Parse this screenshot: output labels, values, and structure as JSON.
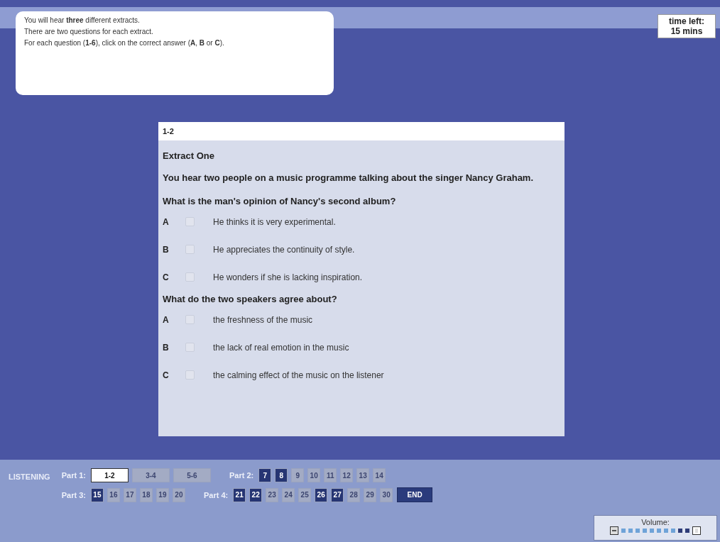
{
  "instructions": [
    "You will hear **three** different extracts.",
    "There are two questions for each extract.",
    "For each question (**1-6**), click on the correct answer (**A**, **B** or **C**)."
  ],
  "timer": {
    "label": "time left:",
    "value": "15 mins"
  },
  "panel": {
    "header": "1-2",
    "extract": "Extract One",
    "context": "You hear two people on a music programme talking about the singer Nancy Graham.",
    "questions": [
      {
        "text": "What is the man's opinion of Nancy's second album?",
        "options": [
          {
            "letter": "A",
            "text": "He thinks it is very experimental.",
            "selected": false
          },
          {
            "letter": "B",
            "text": "He appreciates the continuity of style.",
            "selected": false
          },
          {
            "letter": "C",
            "text": "He wonders if she is lacking inspiration.",
            "selected": false
          }
        ]
      },
      {
        "text": "What do the two speakers agree about?",
        "options": [
          {
            "letter": "A",
            "text": "the freshness of the music",
            "selected": false
          },
          {
            "letter": "B",
            "text": "the lack of real emotion in the music",
            "selected": false
          },
          {
            "letter": "C",
            "text": "the calming effect of the music on the listener",
            "selected": false
          }
        ]
      }
    ]
  },
  "navigation": {
    "section": "LISTENING",
    "rows": [
      {
        "parts": [
          {
            "label": "Part 1:",
            "kind": "range",
            "items": [
              {
                "label": "1-2",
                "selected": true,
                "answered": false
              },
              {
                "label": "3-4",
                "selected": false,
                "answered": false
              },
              {
                "label": "5-6",
                "selected": false,
                "answered": false
              }
            ]
          },
          {
            "label": "Part 2:",
            "kind": "number",
            "items": [
              {
                "label": "7",
                "selected": false,
                "answered": true
              },
              {
                "label": "8",
                "selected": false,
                "answered": true
              },
              {
                "label": "9",
                "selected": false,
                "answered": false
              },
              {
                "label": "10",
                "selected": false,
                "answered": false
              },
              {
                "label": "11",
                "selected": false,
                "answered": false
              },
              {
                "label": "12",
                "selected": false,
                "answered": false
              },
              {
                "label": "13",
                "selected": false,
                "answered": false
              },
              {
                "label": "14",
                "selected": false,
                "answered": false
              }
            ]
          }
        ]
      },
      {
        "parts": [
          {
            "label": "Part 3:",
            "kind": "number",
            "items": [
              {
                "label": "15",
                "selected": false,
                "answered": true
              },
              {
                "label": "16",
                "selected": false,
                "answered": false
              },
              {
                "label": "17",
                "selected": false,
                "answered": false
              },
              {
                "label": "18",
                "selected": false,
                "answered": false
              },
              {
                "label": "19",
                "selected": false,
                "answered": false
              },
              {
                "label": "20",
                "selected": false,
                "answered": false
              }
            ]
          },
          {
            "label": "Part 4:",
            "kind": "number",
            "items": [
              {
                "label": "21",
                "selected": false,
                "answered": true
              },
              {
                "label": "22",
                "selected": false,
                "answered": true
              },
              {
                "label": "23",
                "selected": false,
                "answered": false
              },
              {
                "label": "24",
                "selected": false,
                "answered": false
              },
              {
                "label": "25",
                "selected": false,
                "answered": false
              },
              {
                "label": "26",
                "selected": false,
                "answered": true
              },
              {
                "label": "27",
                "selected": false,
                "answered": true
              },
              {
                "label": "28",
                "selected": false,
                "answered": false
              },
              {
                "label": "29",
                "selected": false,
                "answered": false
              },
              {
                "label": "30",
                "selected": false,
                "answered": false
              }
            ]
          }
        ]
      }
    ],
    "end_button": "END"
  },
  "volume": {
    "label": "Volume:"
  }
}
